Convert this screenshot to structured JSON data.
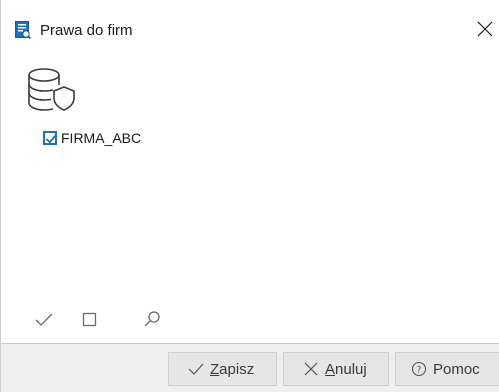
{
  "window": {
    "title": "Prawa do firm",
    "icon": "app-document-icon",
    "close_icon": "close-icon"
  },
  "content": {
    "header_icon": "database-shield-icon",
    "tree": [
      {
        "label": "FIRMA_ABC",
        "checked": true
      }
    ]
  },
  "toolbar": {
    "icons": [
      "check-all-icon",
      "uncheck-all-icon",
      "search-icon"
    ]
  },
  "buttons": {
    "save": {
      "mnemonic": "Z",
      "rest": "apisz",
      "icon": "checkmark-icon"
    },
    "cancel": {
      "mnemonic": "A",
      "rest": "nuluj",
      "icon": "x-icon"
    },
    "help": {
      "label": "Pomoc",
      "icon": "question-circle-icon"
    }
  },
  "colors": {
    "accent": "#1f6fb9",
    "status_bar": "#efefef",
    "button_bg": "#e6e6e6"
  }
}
